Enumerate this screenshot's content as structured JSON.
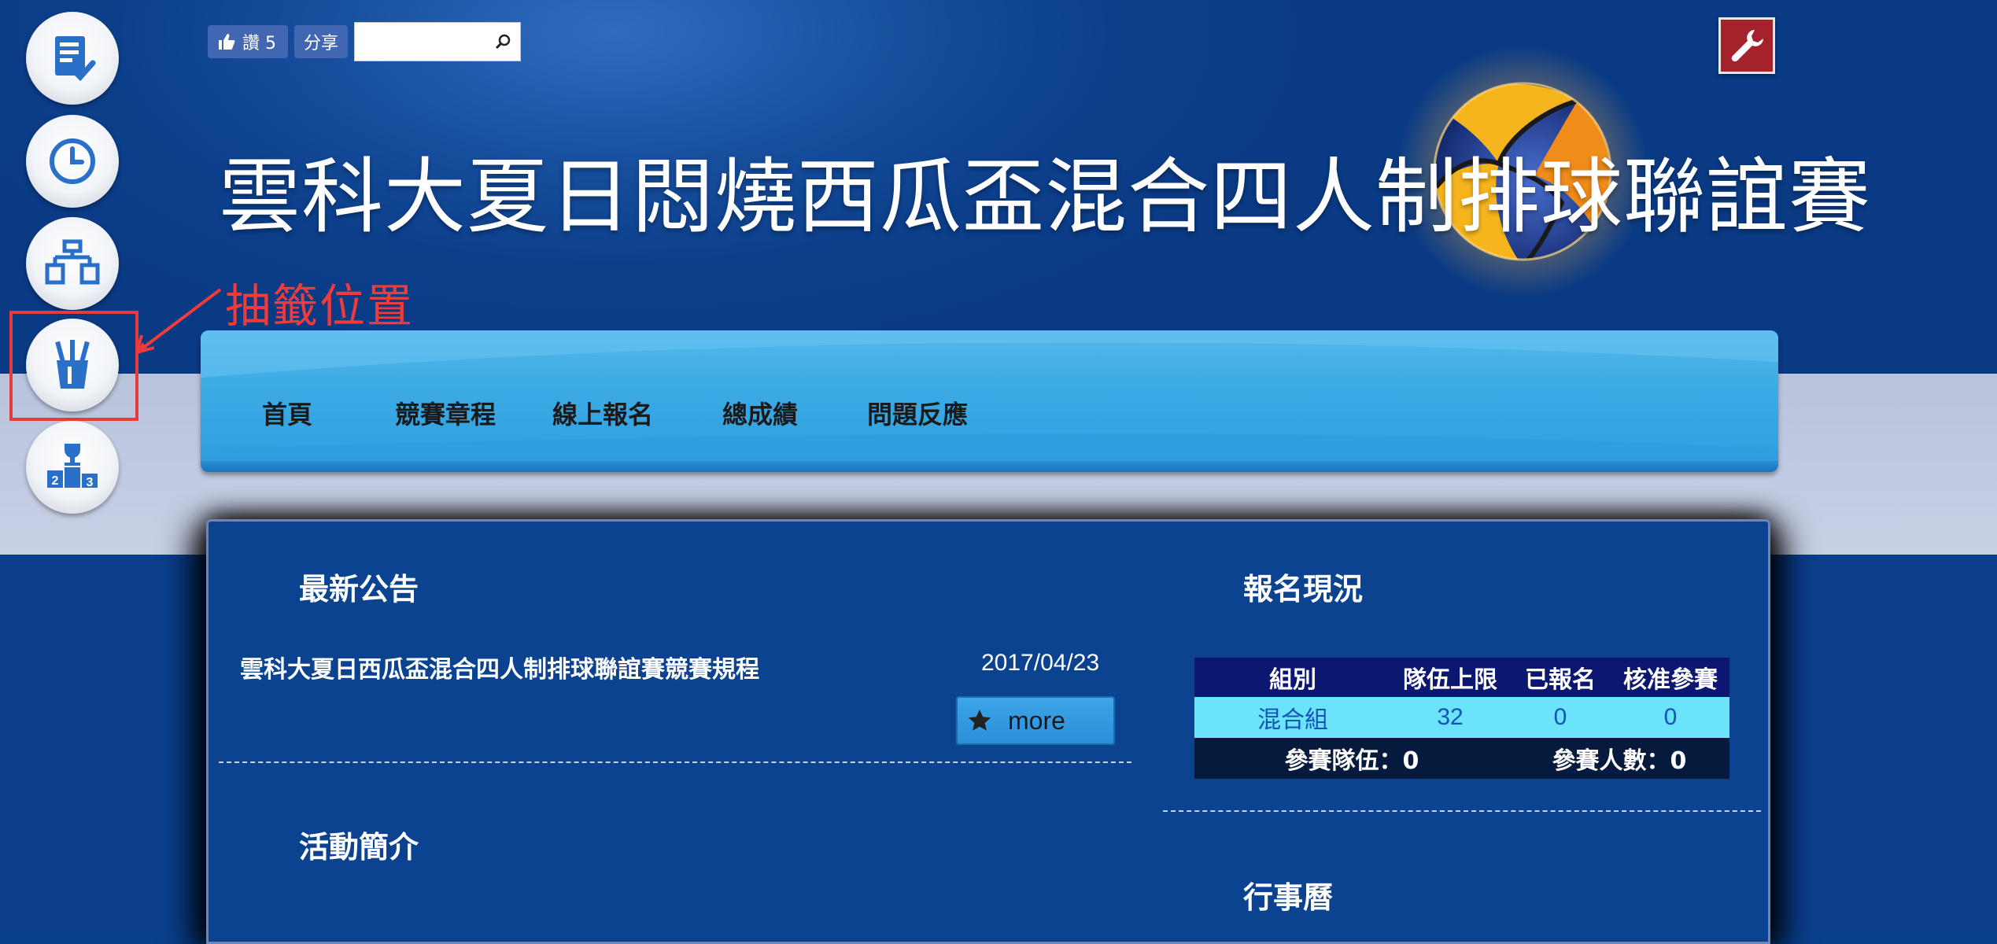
{
  "toolbar": {
    "like_label": "讚 5",
    "share_label": "分享",
    "search_placeholder": ""
  },
  "site": {
    "title": "雲科大夏日悶燒西瓜盃混合四人制排球聯誼賽"
  },
  "annotation": {
    "label": "抽籤位置",
    "color": "#ee3b3b"
  },
  "side_rail": [
    {
      "icon": "registration-list-icon"
    },
    {
      "icon": "clock-icon"
    },
    {
      "icon": "bracket-icon"
    },
    {
      "icon": "lottery-cup-icon"
    },
    {
      "icon": "podium-trophy-icon"
    }
  ],
  "nav": {
    "items": [
      {
        "label": "首頁"
      },
      {
        "label": "競賽章程"
      },
      {
        "label": "線上報名"
      },
      {
        "label": "總成績"
      },
      {
        "label": "問題反應"
      }
    ]
  },
  "main": {
    "news": {
      "title": "最新公告",
      "items": [
        {
          "text": "雲科大夏日西瓜盃混合四人制排球聯誼賽競賽規程",
          "date": "2017/04/23"
        }
      ],
      "more_label": "more"
    },
    "intro": {
      "title": "活動簡介"
    },
    "registration": {
      "title": "報名現況",
      "columns": [
        "組別",
        "隊伍上限",
        "已報名",
        "核准參賽"
      ],
      "rows": [
        [
          "混合組",
          "32",
          "0",
          "0"
        ]
      ],
      "summary": {
        "teams": "參賽隊伍：0",
        "people": "參賽人數：0"
      }
    },
    "calendar": {
      "title": "行事曆"
    }
  },
  "colors": {
    "header_bg": "#0c3f8b",
    "nav_bg": "#3aa9e4",
    "panel_bg": "#0c4390",
    "table_header": "#0b1770",
    "table_row": "#6be3fb",
    "table_summary": "#061a3d",
    "tool_button": "#a4222c"
  }
}
